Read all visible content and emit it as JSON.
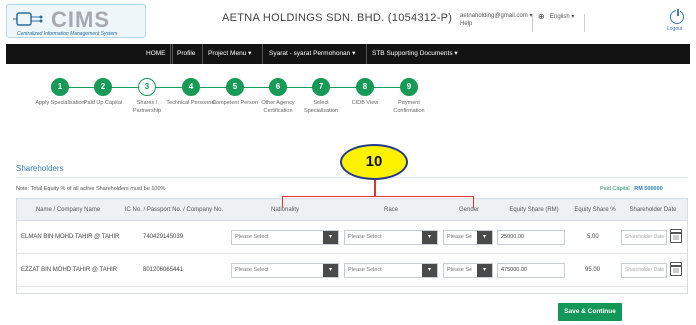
{
  "header": {
    "logo_text": "CIMS",
    "logo_subtitle": "Centralized Information Management System",
    "company": "AETNA HOLDINGS SDN. BHD. (1054312-P)",
    "email": "aetnaholding@gmail.com",
    "help": "Help",
    "language": "English",
    "logout": "Logout"
  },
  "nav": {
    "items": [
      "HOME",
      "Profile",
      "Project Menu",
      "Syarat - syarat Permohonan",
      "STB Supporting Documents"
    ]
  },
  "steps": [
    {
      "num": "1",
      "label": "Apply Specialisation",
      "state": "done"
    },
    {
      "num": "2",
      "label": "Paid Up Capital",
      "state": "done"
    },
    {
      "num": "3",
      "label": "Shares / Partnership",
      "state": "current"
    },
    {
      "num": "4",
      "label": "Technical Personnel",
      "state": "done"
    },
    {
      "num": "5",
      "label": "Competent Person",
      "state": "done"
    },
    {
      "num": "6",
      "label": "Other Agency Certification",
      "state": "done"
    },
    {
      "num": "7",
      "label": "Select Specialisation",
      "state": "done"
    },
    {
      "num": "8",
      "label": "CIDB View",
      "state": "done"
    },
    {
      "num": "9",
      "label": "Payment Confirmation",
      "state": "done"
    }
  ],
  "callout": {
    "number": "10"
  },
  "section": {
    "title": "Shareholders",
    "note": "Note: Total Equity % of all active Shareholders must be 100%",
    "paid_capital_label": "Paid Capital :",
    "paid_capital_value": "RM 500000"
  },
  "table": {
    "headers": [
      "Name / Company Name",
      "IC No. / Passport No. / Company No.",
      "Nationality",
      "Race",
      "Gender",
      "Equity Share (RM)",
      "Equity Share %",
      "Shareholder Date"
    ],
    "select_placeholder": "Please Select",
    "gender_placeholder": "Please Se",
    "date_placeholder": "Shareholder Date",
    "rows": [
      {
        "name": "ELMAN BIN MOHD TAHIR @ TAHIR",
        "ic": "740429145039",
        "equity_rm": "25000.00",
        "equity_pct": "5.00"
      },
      {
        "name": "EZZAT BIN MOHD TAHIR @ TAHIR",
        "ic": "801206065441",
        "equity_rm": "475000.00",
        "equity_pct": "95.00"
      }
    ]
  },
  "actions": {
    "save_continue": "Save & Continue"
  },
  "colors": {
    "accent_green": "#169a56",
    "nav_bg": "#131313",
    "callout_yellow": "#fff200",
    "bracket_red": "#e0342c"
  }
}
